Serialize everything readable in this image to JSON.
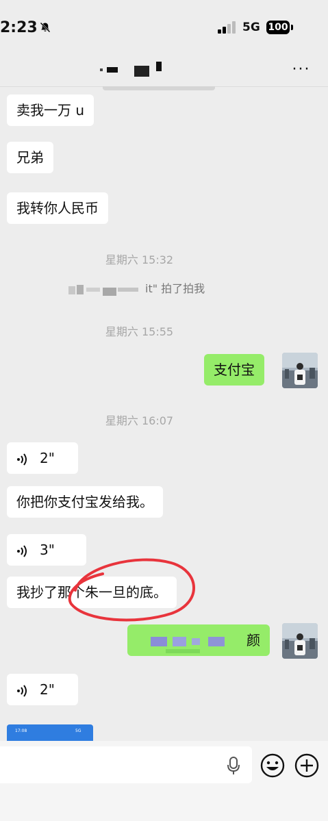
{
  "status_bar": {
    "time": "2:23",
    "network": "5G",
    "battery": "100"
  },
  "header": {
    "more": "···"
  },
  "messages": {
    "m1": "卖我一万 u",
    "m2": "兄弟",
    "m3": "我转你人民币",
    "ts1": "星期六 15:32",
    "system_suffix": "it\" 拍了拍我",
    "ts2": "星期六 15:55",
    "m4": "支付宝",
    "ts3": "星期六 16:07",
    "voice1": "2\"",
    "m5": "你把你支付宝发给我。",
    "voice2": "3\"",
    "m6": "我抄了那个朱一旦的底。",
    "m7_end": "颜",
    "voice3": "2\""
  },
  "thumb": {
    "time": "17:08",
    "net": "5G"
  },
  "colors": {
    "background": "#ededed",
    "bubble_left": "#ffffff",
    "bubble_right": "#95ec69",
    "annotation": "#e8343c"
  },
  "icons": {
    "mute": "bell-slash-icon",
    "voice": "voice-wave-icon",
    "mic": "microphone-icon",
    "emoji": "smiley-icon",
    "plus": "plus-circle-icon"
  }
}
